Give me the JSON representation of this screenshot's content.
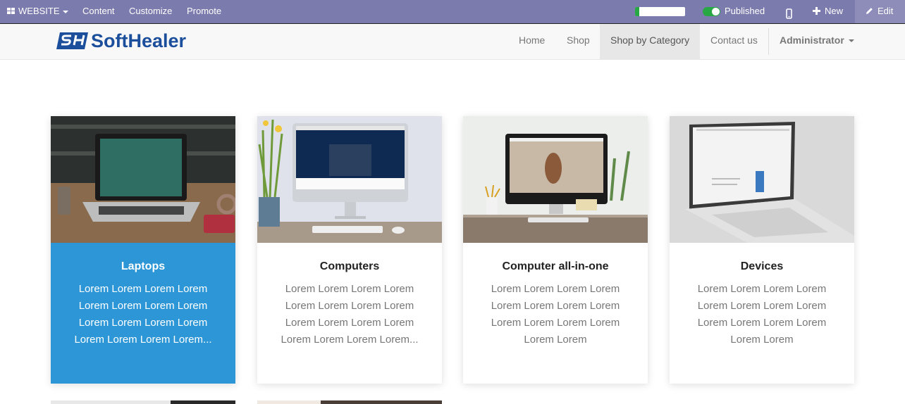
{
  "editbar": {
    "website_label": "WEBSITE",
    "content_label": "Content",
    "customize_label": "Customize",
    "promote_label": "Promote",
    "progress_fraction": 0.08,
    "published_label": "Published",
    "new_label": "New",
    "edit_label": "Edit"
  },
  "header": {
    "logo_text": "SoftHealer",
    "nav": [
      "Home",
      "Shop",
      "Shop by Category",
      "Contact us"
    ],
    "active_nav": "Shop by Category",
    "user_label": "Administrator"
  },
  "cards": [
    {
      "title": "Laptops",
      "lines": [
        "Lorem Lorem Lorem Lorem",
        "Lorem Lorem Lorem Lorem",
        "Lorem Lorem Lorem Lorem",
        "Lorem Lorem Lorem Lorem..."
      ],
      "highlighted": true
    },
    {
      "title": "Computers",
      "lines": [
        "Lorem Lorem Lorem Lorem",
        "Lorem Lorem Lorem Lorem",
        "Lorem Lorem Lorem Lorem",
        "Lorem Lorem Lorem Lorem..."
      ],
      "highlighted": false
    },
    {
      "title": "Computer all-in-one",
      "lines": [
        "Lorem Lorem Lorem Lorem",
        "Lorem Lorem Lorem Lorem",
        "Lorem Lorem Lorem Lorem",
        "Lorem Lorem"
      ],
      "highlighted": false
    },
    {
      "title": "Devices",
      "lines": [
        "Lorem Lorem Lorem Lorem",
        "Lorem Lorem Lorem Lorem",
        "Lorem Lorem Lorem Lorem",
        "Lorem Lorem"
      ],
      "highlighted": false
    }
  ],
  "colors": {
    "editbar": "#7c7bad",
    "accent": "#2d96d6",
    "published_toggle": "#28a745"
  },
  "icons": [
    "grid-icon",
    "mobile-icon",
    "plus-icon",
    "pencil-icon",
    "caret-down-icon"
  ]
}
